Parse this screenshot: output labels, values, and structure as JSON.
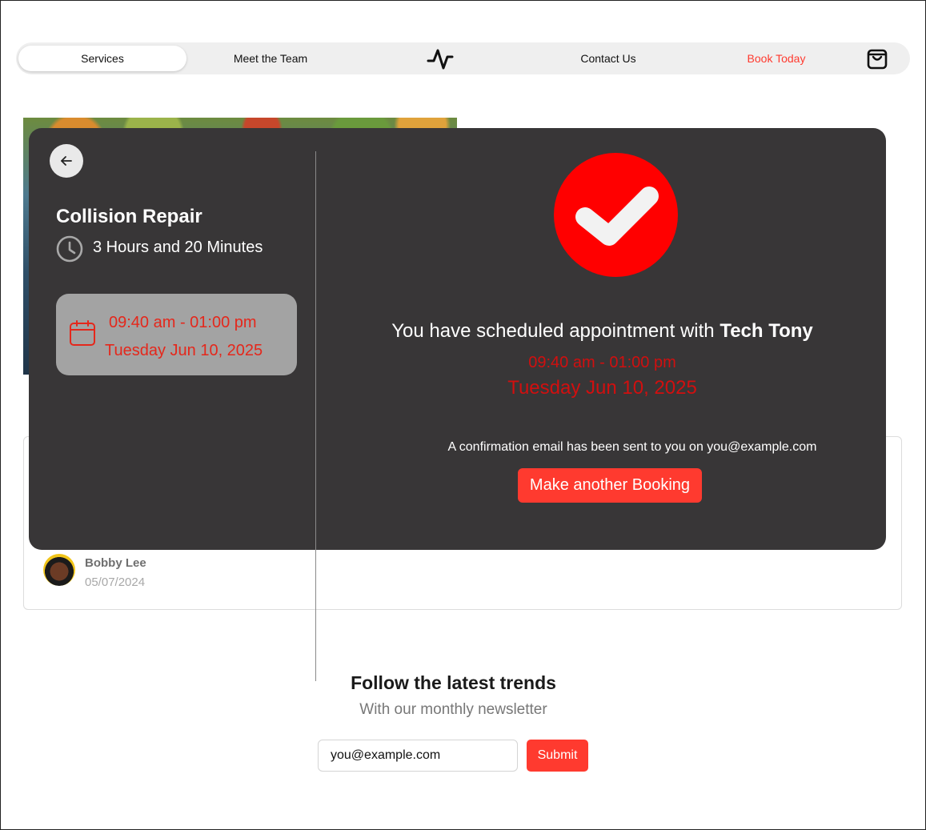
{
  "nav": {
    "services": "Services",
    "team": "Meet the Team",
    "logo_icon": "pulse-icon",
    "contact": "Contact Us",
    "book": "Book Today",
    "cart_icon": "shopping-bag-icon",
    "accent_color": "#ff3a2f"
  },
  "modal": {
    "back_icon": "arrow-left-icon",
    "service_name": "Collision Repair",
    "duration": "3 Hours and 20 Minutes",
    "slot": {
      "time": "09:40 am - 01:00 pm",
      "date": "Tuesday Jun 10, 2025"
    },
    "confirmation": {
      "message_prefix": "You have scheduled appointment with",
      "tech_name": "Tech Tony",
      "time": "09:40 am - 01:00 pm",
      "date": "Tuesday Jun 10, 2025",
      "email_note": "A confirmation email has been sent to you on you@example.com",
      "button": "Make another Booking"
    }
  },
  "review": {
    "name": "Bobby Lee",
    "date": "05/07/2024"
  },
  "newsletter": {
    "title": "Follow the latest trends",
    "subtitle": "With our monthly newsletter",
    "email_value": "you@example.com",
    "submit": "Submit"
  }
}
